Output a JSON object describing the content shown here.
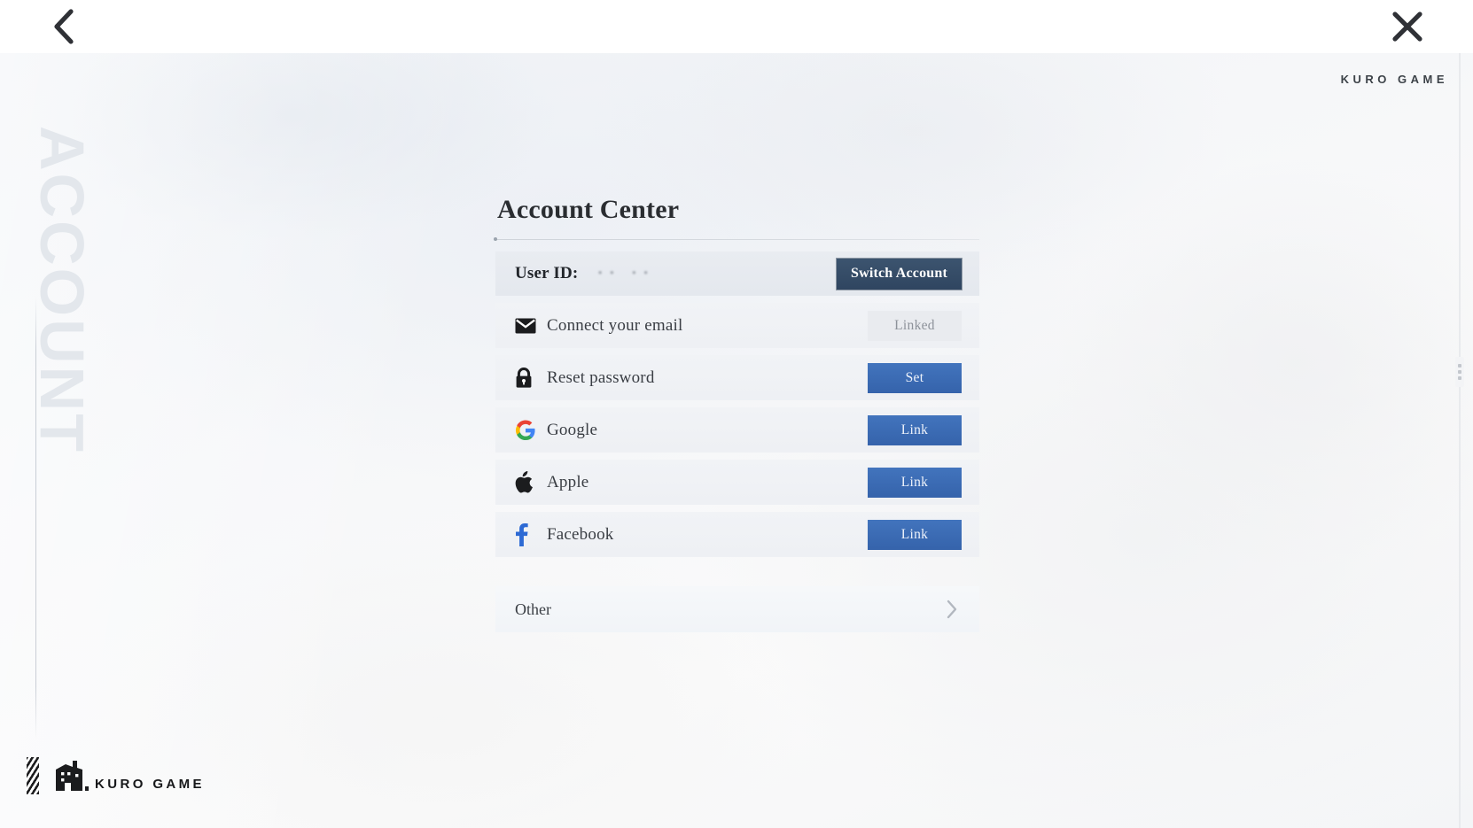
{
  "window": {
    "back_label": "Back",
    "close_label": "Close"
  },
  "branding": {
    "top_right": "KURO GAME",
    "bottom_left": "KURO GAME",
    "watermark": "ACCOUNT"
  },
  "panel": {
    "title": "Account Center",
    "user_id": {
      "label": "User ID:",
      "value": "•• ••",
      "switch_button": "Switch Account"
    },
    "rows": [
      {
        "icon": "email-icon",
        "label": "Connect your email",
        "action_label": "Linked",
        "action_type": "badge",
        "state": "linked"
      },
      {
        "icon": "lock-icon",
        "label": "Reset password",
        "action_label": "Set",
        "action_type": "button",
        "state": "unset"
      },
      {
        "icon": "google-icon",
        "label": "Google",
        "action_label": "Link",
        "action_type": "button",
        "state": "unlinked"
      },
      {
        "icon": "apple-icon",
        "label": "Apple",
        "action_label": "Link",
        "action_type": "button",
        "state": "unlinked"
      },
      {
        "icon": "facebook-icon",
        "label": "Facebook",
        "action_label": "Link",
        "action_type": "button",
        "state": "unlinked"
      }
    ],
    "other": {
      "label": "Other",
      "chevron": "chevron-right-icon"
    }
  },
  "colors": {
    "accent_blue": "#3b68b0",
    "switch_navy": "#354c67",
    "badge_grey": "#e9ebef",
    "badge_text": "#8d929a",
    "row_bg": "#f1f3f6",
    "title_text": "#2a2d31",
    "watermark": "#e3e7ec"
  }
}
